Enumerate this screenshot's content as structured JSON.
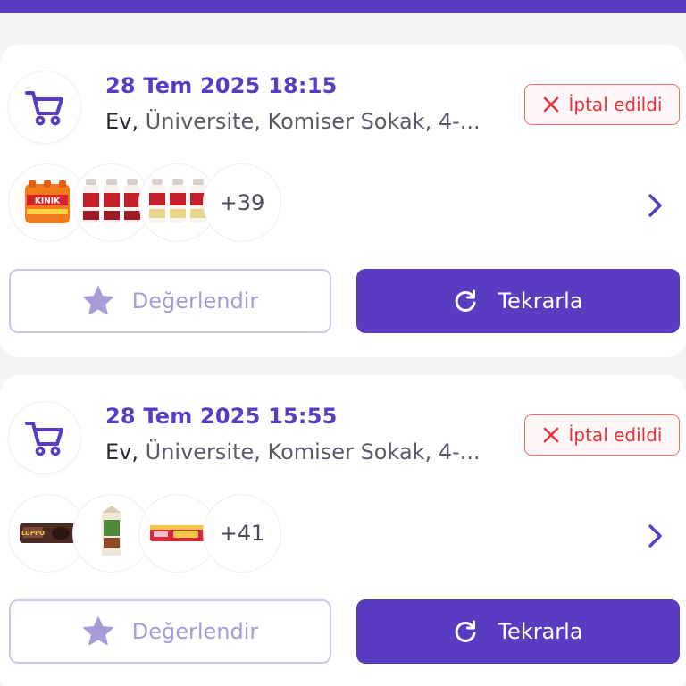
{
  "orders": [
    {
      "date": "28 Tem 2025 18:15",
      "address_label": "Ev,",
      "address_text": "Üniversite, Komiser Sokak, 4-...",
      "status": "İptal edildi",
      "more_count": "+39",
      "product_thumbs": [
        "kinik-water-pack",
        "seker-ayran-bottles",
        "seker-kefir-bottles"
      ],
      "rate_label": "Değerlendir",
      "repeat_label": "Tekrarla"
    },
    {
      "date": "28 Tem 2025 15:55",
      "address_label": "Ev,",
      "address_text": "Üniversite, Komiser Sokak, 4-...",
      "status": "İptal edildi",
      "more_count": "+41",
      "product_thumbs": [
        "luppo-cake-bar",
        "milk-carton",
        "chocolate-wafer"
      ],
      "rate_label": "Değerlendir",
      "repeat_label": "Tekrarla"
    }
  ],
  "colors": {
    "brand": "#5a3cc2",
    "cancel": "#e8323a",
    "rate_text": "#a89bd8"
  }
}
